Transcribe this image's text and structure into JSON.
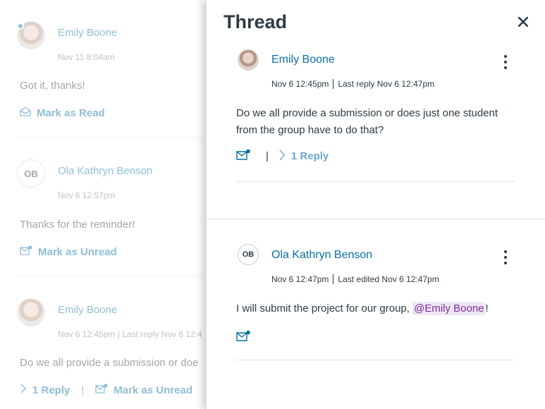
{
  "background_list": {
    "entries": [
      {
        "author": "Emily Boone",
        "timestamp": "Nov 11 8:04am",
        "message": "Got it, thanks!",
        "action": "Mark as Read",
        "avatar": "photo",
        "unread": true
      },
      {
        "author": "Ola Kathryn Benson",
        "initials": "OB",
        "timestamp": "Nov 6 12:57pm",
        "message": "Thanks for the reminder!",
        "action": "Mark as Unread"
      },
      {
        "author": "Emily Boone",
        "timestamp": "Nov 6 12:45pm",
        "last_reply": "Last reply Nov 6 12:4",
        "message": "Do we all provide a submission or doe",
        "reply_label": "1 Reply",
        "action": "Mark as Unread",
        "avatar": "photo"
      }
    ]
  },
  "tray": {
    "title": "Thread",
    "close_icon": "close-icon",
    "entries": [
      {
        "author": "Emily Boone",
        "timestamp": "Nov 6 12:45pm",
        "secondary": "Last reply Nov 6 12:47pm",
        "message": "Do we all provide a submission or does just one student from the group have to do that?",
        "reply_label": "1 Reply",
        "separator": "|"
      },
      {
        "author": "Ola Kathryn Benson",
        "initials": "OB",
        "timestamp": "Nov 6 12:47pm",
        "secondary": "Last edited Nov 6 12:47pm",
        "message_before": "I will submit the project for our group, ",
        "mention": "@Emily Boone",
        "message_after": "!"
      }
    ]
  },
  "colors": {
    "link": "#0770a3",
    "text": "#2d3b45",
    "mention_bg": "#efe6f5",
    "mention_text": "#7d2d9e",
    "unread_dot": "#0b7bc3"
  }
}
